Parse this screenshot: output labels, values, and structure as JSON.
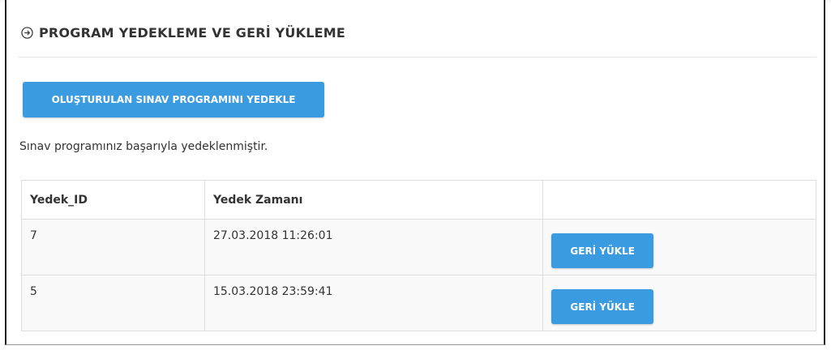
{
  "header": {
    "title": "PROGRAM YEDEKLEME VE GERİ YÜKLEME",
    "icon": "arrow-right-circle-icon"
  },
  "actions": {
    "backup_label": "OLUŞTURULAN SINAV PROGRAMINI YEDEKLE"
  },
  "status": {
    "message": "Sınav programınız başarıyla yedeklenmiştir."
  },
  "table": {
    "columns": [
      "Yedek_ID",
      "Yedek Zamanı",
      ""
    ],
    "rows": [
      {
        "id": "7",
        "time": "27.03.2018 11:26:01",
        "action": "GERİ YÜKLE"
      },
      {
        "id": "5",
        "time": "15.03.2018 23:59:41",
        "action": "GERİ YÜKLE"
      }
    ]
  },
  "colors": {
    "accent": "#3a9be0",
    "text": "#333333",
    "border": "#dddddd"
  }
}
